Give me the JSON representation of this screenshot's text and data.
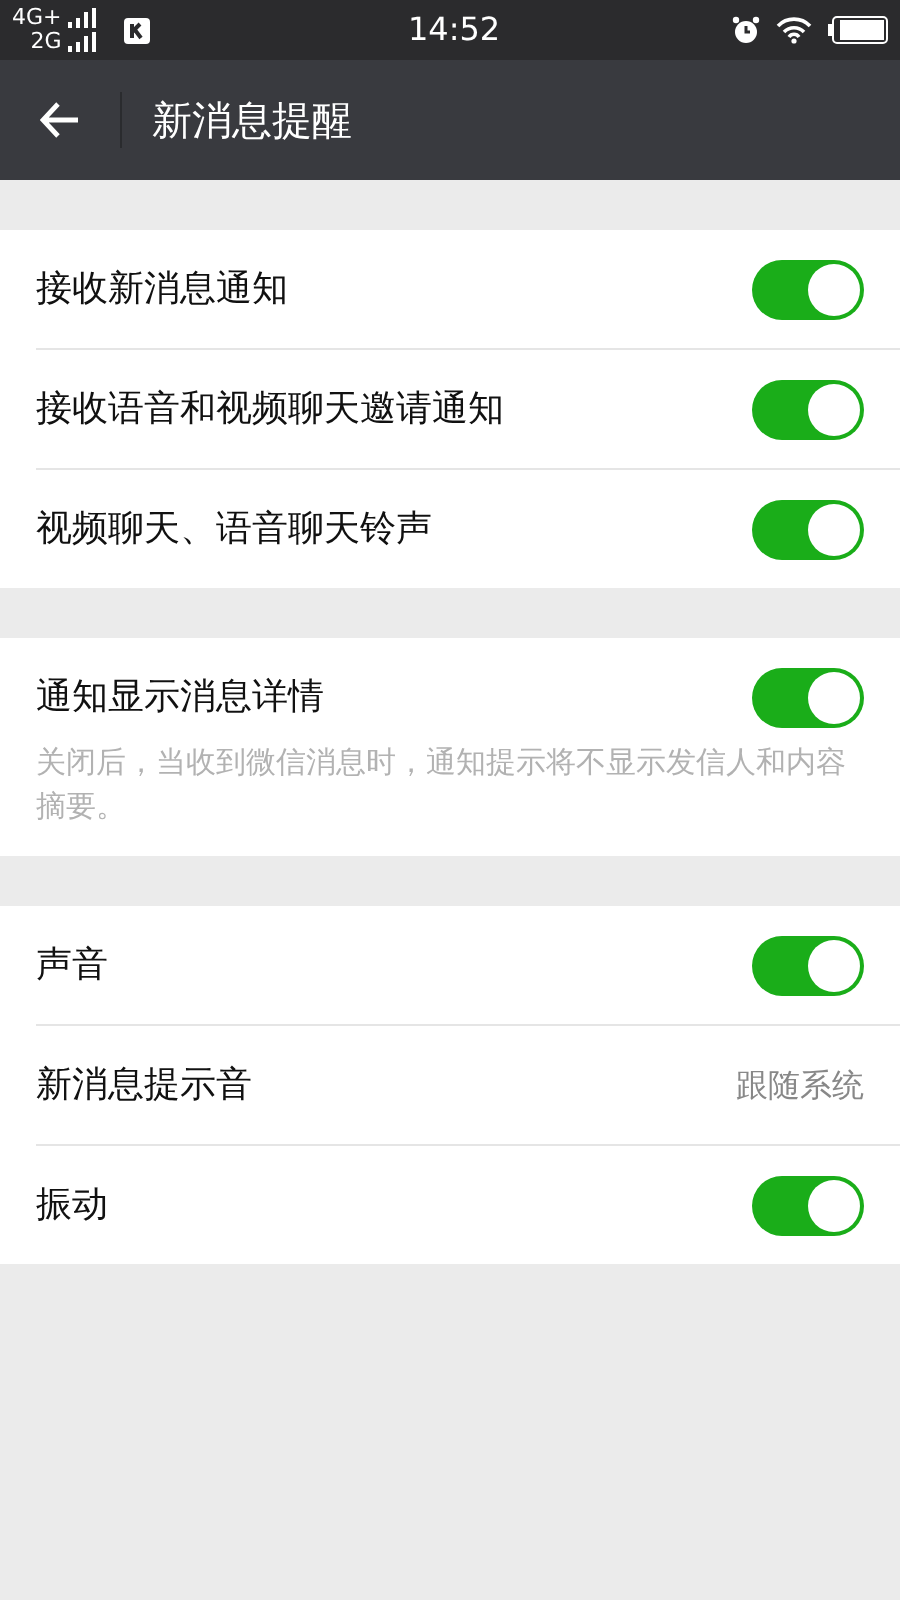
{
  "status_bar": {
    "network_1": "4G+",
    "network_2": "2G",
    "time": "14:52"
  },
  "app_bar": {
    "title": "新消息提醒"
  },
  "groups": [
    {
      "rows": [
        {
          "kind": "toggle",
          "label": "接收新消息通知",
          "on": true
        },
        {
          "kind": "toggle",
          "label": "接收语音和视频聊天邀请通知",
          "on": true
        },
        {
          "kind": "toggle",
          "label": "视频聊天、语音聊天铃声",
          "on": true
        }
      ]
    },
    {
      "rows": [
        {
          "kind": "toggle",
          "label": "通知显示消息详情",
          "on": true,
          "description": "关闭后，当收到微信消息时，通知提示将不显示发信人和内容摘要。"
        }
      ]
    },
    {
      "rows": [
        {
          "kind": "toggle",
          "label": "声音",
          "on": true
        },
        {
          "kind": "value",
          "label": "新消息提示音",
          "value": "跟随系统"
        },
        {
          "kind": "toggle",
          "label": "振动",
          "on": true
        }
      ]
    }
  ]
}
